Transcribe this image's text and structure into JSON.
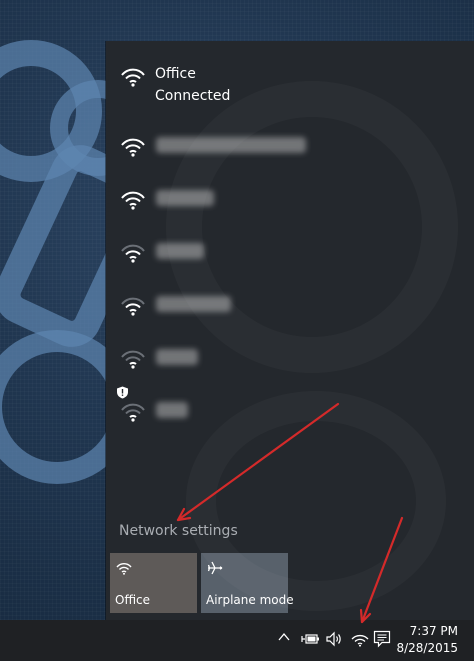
{
  "networks": [
    {
      "name": "Office",
      "status": "Connected"
    }
  ],
  "network_settings_label": "Network settings",
  "quick_actions": [
    {
      "label": "Office"
    },
    {
      "label": "Airplane mode"
    }
  ],
  "taskbar": {
    "time": "7:37 PM",
    "date": "8/28/2015"
  },
  "icons": {
    "wifi": "wifi-icon",
    "airplane": "airplane-icon",
    "chevron": "chevron-up-icon",
    "battery": "battery-icon",
    "volume": "volume-icon",
    "action_center": "action-center-icon"
  },
  "colors": {
    "flyout_bg": "#24282d",
    "tile_bg": "#58616b",
    "annotation": "#d42a2a"
  }
}
